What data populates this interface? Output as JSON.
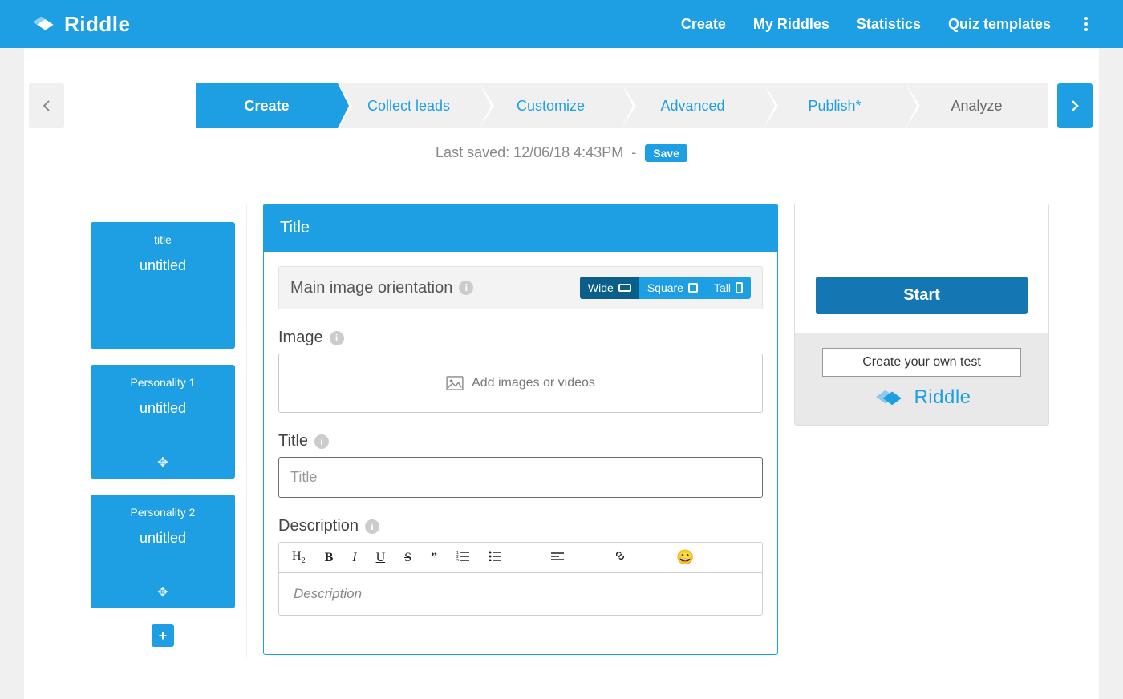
{
  "brand": "Riddle",
  "nav": {
    "create": "Create",
    "my_riddles": "My Riddles",
    "statistics": "Statistics",
    "templates": "Quiz templates"
  },
  "steps": {
    "create": "Create",
    "collect": "Collect leads",
    "customize": "Customize",
    "advanced": "Advanced",
    "publish": "Publish*",
    "analyze": "Analyze"
  },
  "saved": {
    "label": "Last saved: 12/06/18 4:43PM",
    "separator": "-",
    "save_btn": "Save"
  },
  "sidebar": {
    "tiles": [
      {
        "type": "title",
        "title": "untitled"
      },
      {
        "type": "Personality 1",
        "title": "untitled"
      },
      {
        "type": "Personality 2",
        "title": "untitled"
      }
    ]
  },
  "editor": {
    "header": "Title",
    "orient_label": "Main image orientation",
    "orient_options": {
      "wide": "Wide",
      "square": "Square",
      "tall": "Tall"
    },
    "image_label": "Image",
    "image_dz": "Add images or videos",
    "title_label": "Title",
    "title_placeholder": "Title",
    "title_value": "",
    "desc_label": "Description",
    "desc_placeholder": "Description"
  },
  "preview": {
    "start": "Start",
    "cta": "Create your own test",
    "brand": "Riddle"
  }
}
